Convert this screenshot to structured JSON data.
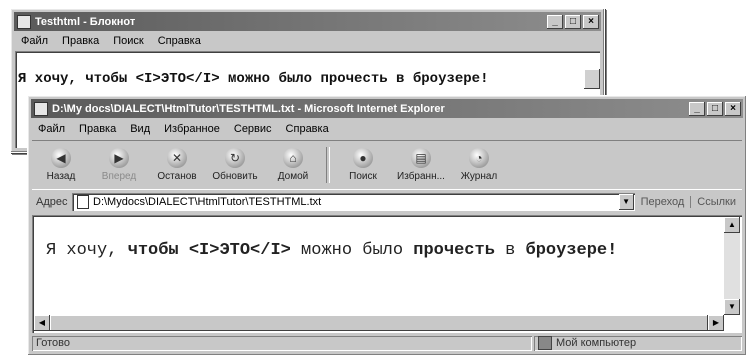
{
  "notepad": {
    "title": "Testhtml - Блокнот",
    "menu": [
      "Файл",
      "Правка",
      "Поиск",
      "Справка"
    ],
    "text": "Я хочу, чтобы <I>ЭТО</I> можно было прочесть в броузере!"
  },
  "ie": {
    "title": "D:\\My docs\\DIALECT\\HtmlTutor\\TESTHTML.txt - Microsoft Internet Explorer",
    "menu": [
      "Файл",
      "Правка",
      "Вид",
      "Избранное",
      "Сервис",
      "Справка"
    ],
    "toolbar": {
      "back": "Назад",
      "forward": "Вперед",
      "stop": "Останов",
      "refresh": "Обновить",
      "home": "Домой",
      "search": "Поиск",
      "favorites": "Избранн...",
      "history": "Журнал"
    },
    "address": {
      "label": "Адрес",
      "value": "D:\\Mydocs\\DIALECT\\HtmlTutor\\TESTHTML.txt",
      "go": "Переход",
      "links": "Ссылки"
    },
    "content": {
      "part1": "Я хочу, ",
      "part2": "чтобы <I>ЭТО</I>",
      "part3": " можно было ",
      "part4": "прочесть",
      "part5": " в ",
      "part6": "броузере!"
    },
    "status": {
      "left": "Готово",
      "zone": "Мой компьютер"
    }
  }
}
